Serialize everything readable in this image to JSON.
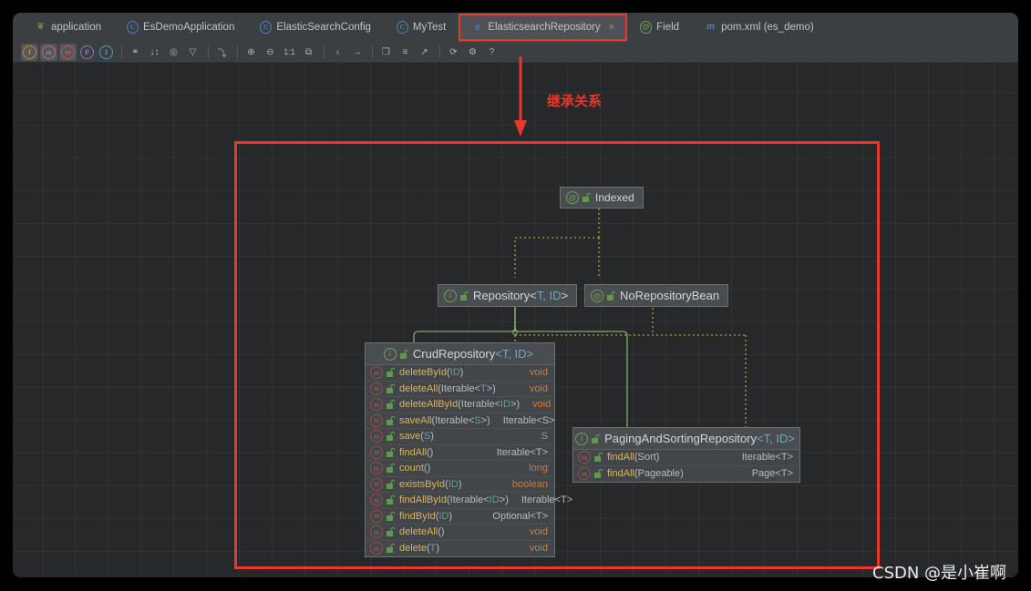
{
  "window": {
    "tabs": [
      {
        "label": "application",
        "icon": "leaf-icon",
        "icon_char": "❦",
        "icon_color": "#5e8c4a",
        "active": false,
        "closable": false
      },
      {
        "label": "EsDemoApplication",
        "icon": "spring-class-icon",
        "icon_char": "C",
        "icon_color": "#4a7fc1",
        "active": false,
        "closable": false
      },
      {
        "label": "ElasticSearchConfig",
        "icon": "java-class-icon",
        "icon_char": "C",
        "icon_color": "#4a7fc1",
        "active": false,
        "closable": false
      },
      {
        "label": "MyTest",
        "icon": "java-class-icon",
        "icon_char": "C",
        "icon_color": "#4a7fc1",
        "active": false,
        "closable": false
      },
      {
        "label": "ElasticsearchRepository",
        "icon": "java-interface-icon",
        "icon_char": "If",
        "icon_color": "#4a7fc1",
        "active": true,
        "closable": true,
        "close_char": "×"
      },
      {
        "label": "Field",
        "icon": "annotation-icon",
        "icon_char": "@",
        "icon_color": "#6f9f5c",
        "active": false,
        "closable": false
      },
      {
        "label": "pom.xml (es_demo)",
        "icon": "maven-icon",
        "icon_char": "m",
        "icon_color": "#4a7fc1",
        "active": false,
        "closable": false
      }
    ],
    "toolbar": [
      {
        "name": "field-toggle-icon",
        "glyph": "f",
        "color": "#c98a3a",
        "kind": "dot",
        "selected": true
      },
      {
        "name": "method-toggle-icon",
        "glyph": "m",
        "color": "#c26a8f",
        "kind": "dot",
        "selected": true
      },
      {
        "name": "constructor-toggle-icon",
        "glyph": "m",
        "color": "#b45c55",
        "kind": "dot",
        "selected": true
      },
      {
        "name": "property-toggle-icon",
        "glyph": "P",
        "color": "#9a6fc4",
        "kind": "dot",
        "selected": false
      },
      {
        "name": "inner-class-toggle-icon",
        "glyph": "I",
        "color": "#4a9cc4",
        "kind": "dot",
        "selected": false
      },
      {
        "name": "separator",
        "kind": "sep"
      },
      {
        "name": "dependencies-icon",
        "glyph": "⚭",
        "color": "#aeb3b7",
        "kind": "glyph"
      },
      {
        "name": "sort-icon",
        "glyph": "↓↕",
        "color": "#aeb3b7",
        "kind": "glyph"
      },
      {
        "name": "visibility-icon",
        "glyph": "◎",
        "color": "#aeb3b7",
        "kind": "glyph"
      },
      {
        "name": "filter-icon",
        "glyph": "▽",
        "color": "#aeb3b7",
        "kind": "glyph"
      },
      {
        "name": "separator",
        "kind": "sep"
      },
      {
        "name": "layout-icon",
        "glyph": "⤵",
        "color": "#aeb3b7",
        "kind": "glyph"
      },
      {
        "name": "separator",
        "kind": "sep"
      },
      {
        "name": "zoom-in-icon",
        "glyph": "⊕",
        "color": "#aeb3b7",
        "kind": "glyph"
      },
      {
        "name": "zoom-out-icon",
        "glyph": "⊖",
        "color": "#aeb3b7",
        "kind": "glyph"
      },
      {
        "name": "actual-size-icon",
        "glyph": "1:1",
        "color": "#aeb3b7",
        "kind": "text"
      },
      {
        "name": "fit-content-icon",
        "glyph": "⧉",
        "color": "#aeb3b7",
        "kind": "glyph"
      },
      {
        "name": "separator",
        "kind": "sep"
      },
      {
        "name": "share-icon",
        "glyph": "‹",
        "color": "#aeb3b7",
        "kind": "glyph"
      },
      {
        "name": "jump-icon",
        "glyph": "→",
        "color": "#aeb3b7",
        "kind": "glyph"
      },
      {
        "name": "separator",
        "kind": "sep"
      },
      {
        "name": "copy-icon",
        "glyph": "❐",
        "color": "#aeb3b7",
        "kind": "glyph"
      },
      {
        "name": "notes-icon",
        "glyph": "≡",
        "color": "#aeb3b7",
        "kind": "glyph"
      },
      {
        "name": "export-icon",
        "glyph": "↗",
        "color": "#aeb3b7",
        "kind": "glyph"
      },
      {
        "name": "separator",
        "kind": "sep"
      },
      {
        "name": "refresh-icon",
        "glyph": "⟳",
        "color": "#aeb3b7",
        "kind": "glyph"
      },
      {
        "name": "settings-icon",
        "glyph": "⚙",
        "color": "#aeb3b7",
        "kind": "glyph"
      },
      {
        "name": "help-icon",
        "glyph": "?",
        "color": "#aeb3b7",
        "kind": "glyph"
      }
    ]
  },
  "diagram": {
    "indexed": {
      "name": "Indexed",
      "kind": "annotation"
    },
    "repository": {
      "name": "Repository",
      "generic_open": "<",
      "generic_t": "T",
      "generic_sep": ", ",
      "generic_id": "ID",
      "generic_close": ">",
      "kind": "interface"
    },
    "no_repository_bean": {
      "name": "NoRepositoryBean",
      "kind": "annotation"
    },
    "crud_repository": {
      "title_name": "CrudRepository",
      "title_generic": "<T, ID>",
      "kind": "interface",
      "methods": [
        {
          "name": "deleteById",
          "params": "(ID)",
          "ret": "void",
          "ret_class": "ret-void"
        },
        {
          "name": "deleteAll",
          "params": "(Iterable<T>)",
          "ret": "void",
          "ret_class": "ret-void"
        },
        {
          "name": "deleteAllById",
          "params": "(Iterable<ID>)",
          "ret": "void",
          "ret_class": "ret-void"
        },
        {
          "name": "saveAll",
          "params": "(Iterable<S>)",
          "ret": "Iterable<S>",
          "ret_class": "ret-obj"
        },
        {
          "name": "save",
          "params": "(S)",
          "ret": "S",
          "ret_class": "ret-S"
        },
        {
          "name": "findAll",
          "params": "()",
          "ret": "Iterable<T>",
          "ret_class": "ret-obj"
        },
        {
          "name": "count",
          "params": "()",
          "ret": "long",
          "ret_class": "ret-long"
        },
        {
          "name": "existsById",
          "params": "(ID)",
          "ret": "boolean",
          "ret_class": "ret-bool"
        },
        {
          "name": "findAllById",
          "params": "(Iterable<ID>)",
          "ret": "Iterable<T>",
          "ret_class": "ret-obj"
        },
        {
          "name": "findById",
          "params": "(ID)",
          "ret": "Optional<T>",
          "ret_class": "ret-obj"
        },
        {
          "name": "deleteAll",
          "params": "()",
          "ret": "void",
          "ret_class": "ret-void"
        },
        {
          "name": "delete",
          "params": "(T)",
          "ret": "void",
          "ret_class": "ret-void"
        }
      ]
    },
    "paging_repository": {
      "title_name": "PagingAndSortingRepository",
      "title_generic": "<T, ID>",
      "kind": "interface",
      "methods": [
        {
          "name": "findAll",
          "params": "(Sort)",
          "ret": "Iterable<T>",
          "ret_class": "ret-obj"
        },
        {
          "name": "findAll",
          "params": "(Pageable)",
          "ret": "Page<T>",
          "ret_class": "ret-obj"
        }
      ]
    }
  },
  "annotations": {
    "arrow_label": "继承关系",
    "accent_red": "#e8382a",
    "watermark": "CSDN @是小崔啊"
  }
}
